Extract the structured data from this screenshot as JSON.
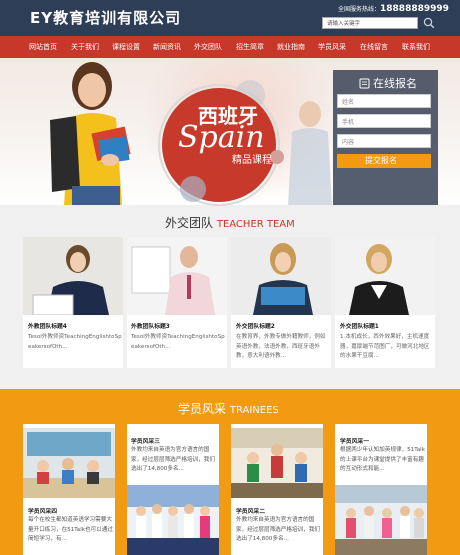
{
  "header": {
    "logo": "EY教育培训有限公司",
    "hotline_label": "全国服务热线：",
    "hotline_number": "18888889999",
    "search_placeholder": "请输入关键字"
  },
  "nav": {
    "items": [
      "网站首页",
      "关于我们",
      "课程设置",
      "新闻资讯",
      "外交团队",
      "招生简章",
      "就业指南",
      "学员风采",
      "在线留言",
      "联系我们"
    ]
  },
  "banner": {
    "title_cn": "西班牙",
    "title_en": "Spain",
    "subtitle": "精品课程"
  },
  "signup": {
    "title": "在线报名",
    "name_placeholder": "姓名",
    "phone_placeholder": "手机",
    "content_placeholder": "内容",
    "submit_label": "提交报名"
  },
  "teachers": {
    "title_cn": "外交团队",
    "title_en": "TEACHER TEAM",
    "items": [
      {
        "title": "外教团队标题4",
        "desc": "Tesol外教师资TeachingEnglishtoSpeakersofOth..."
      },
      {
        "title": "外教团队标题3",
        "desc": "Tesol外教师资TeachingEnglishtoSpeakersofOth..."
      },
      {
        "title": "外交团队标题2",
        "desc": "在教育界，外教专做外籍教师，例如英语外教，法语外教，西班牙语外教，意大利语外教..."
      },
      {
        "title": "外交团队标题1",
        "desc": "1.本机成长，西外效果好，主机速度器，嘉厚端节范图厂，可做河北地区的水果干豆腐..."
      }
    ]
  },
  "trainees": {
    "title_cn": "学员风采",
    "title_en": "TRAINEES",
    "items": [
      {
        "title": "学员风采四",
        "desc": "每个在校生都知道英语学习需要大量开口练习，在51Talk也可以通过简短学习，有..."
      },
      {
        "title": "学员风采三",
        "desc": "外教均来自英语为官方语言的国家，经过层层筛选严格培训，我们选出了14,800多名..."
      },
      {
        "title": "学员风采二",
        "desc": "外教均来自英语为官方语言的国家，经过层层筛选严格培训，我们选出了14,800多名..."
      },
      {
        "title": "学员风采一",
        "desc": "根据两少年认知加英规律，51Talk的上课平台为课堂提供了丰富有趣的互动形式和能..."
      }
    ]
  },
  "colors": {
    "header_bg": "#2e3e57",
    "nav_bg": "#c8382a",
    "accent_orange": "#f29b12",
    "accent_red": "#c73a2b"
  }
}
